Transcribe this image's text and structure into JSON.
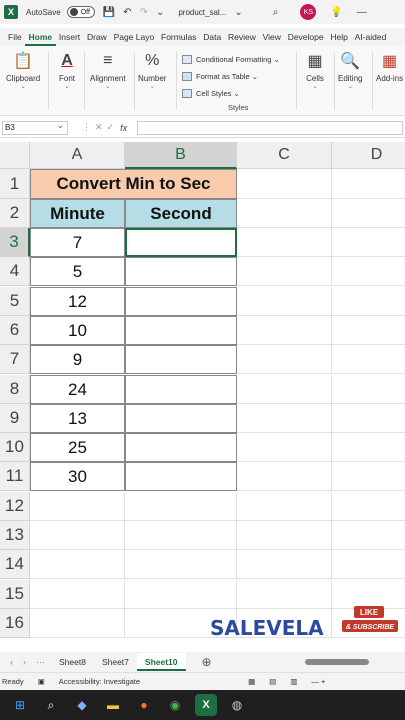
{
  "titlebar": {
    "autosave_label": "AutoSave",
    "autosave_state": "Off",
    "filename": "product_sal...",
    "user_initials": "KS"
  },
  "menu": {
    "items": [
      "File",
      "Home",
      "Insert",
      "Draw",
      "Page Layo",
      "Formulas",
      "Data",
      "Review",
      "View",
      "Develope",
      "Help",
      "AI-aided"
    ],
    "active": "Home"
  },
  "ribbon": {
    "clipboard": "Clipboard",
    "font": "Font",
    "alignment": "Alignment",
    "number": "Number",
    "conditional_formatting": "Conditional Formatting",
    "format_as_table": "Format as Table",
    "cell_styles": "Cell Styles",
    "styles_group": "Styles",
    "cells": "Cells",
    "editing": "Editing",
    "addins": "Add-ins"
  },
  "formula_bar": {
    "name_box": "B3",
    "fx": "fx",
    "value": ""
  },
  "sheet": {
    "columns": [
      "A",
      "B",
      "C",
      "D"
    ],
    "rows": [
      "1",
      "2",
      "3",
      "4",
      "5",
      "6",
      "7",
      "8",
      "9",
      "10",
      "11",
      "12",
      "13",
      "14",
      "15",
      "16"
    ],
    "selected_cell": "B3",
    "title": "Convert Min to Sec",
    "header_minute": "Minute",
    "header_second": "Second",
    "minutes": [
      "7",
      "5",
      "12",
      "10",
      "9",
      "24",
      "13",
      "25",
      "30"
    ]
  },
  "tabs": {
    "items": [
      "Sheet8",
      "Sheet7",
      "Sheet10"
    ],
    "active": "Sheet10"
  },
  "status": {
    "ready": "Ready",
    "accessibility": "Accessibility: Investigate"
  },
  "watermark": {
    "brand": "SALEVELA",
    "like": "LIKE",
    "subscribe": "& SUBSCRIBE"
  },
  "colors": {
    "excel_green": "#1d6f42",
    "title_fill": "#f8cbad",
    "header_fill": "#b4dde6"
  }
}
